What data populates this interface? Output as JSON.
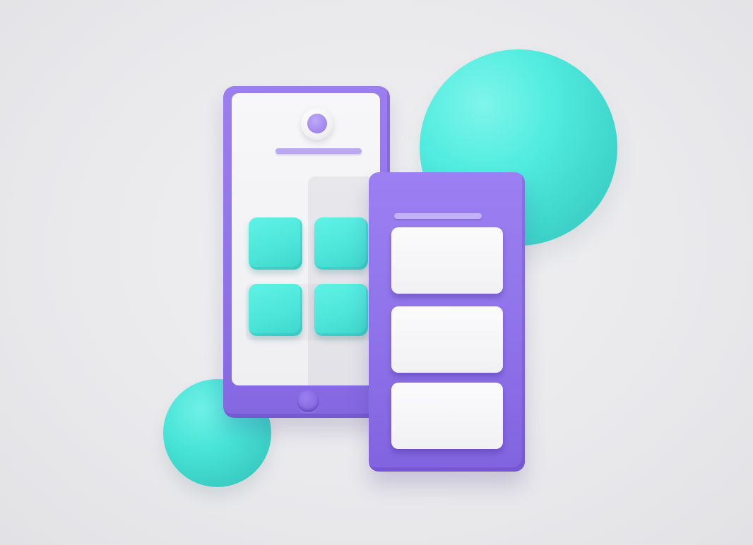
{
  "scene": {
    "description_free": true,
    "elements": {
      "large_sphere_color": "#52ece0",
      "small_sphere_color": "#48e4d8",
      "phone_color": "#8f72ea",
      "panel_color": "#8f72ea",
      "screen_color": "#f3f3f6",
      "tile_color": "#4de6da",
      "accent_bar_color": "#b9a8f3"
    },
    "phone": {
      "tile_count": 4,
      "icons": [
        "avatar-icon",
        "home-button-icon"
      ]
    },
    "panel": {
      "card_count": 3
    }
  }
}
